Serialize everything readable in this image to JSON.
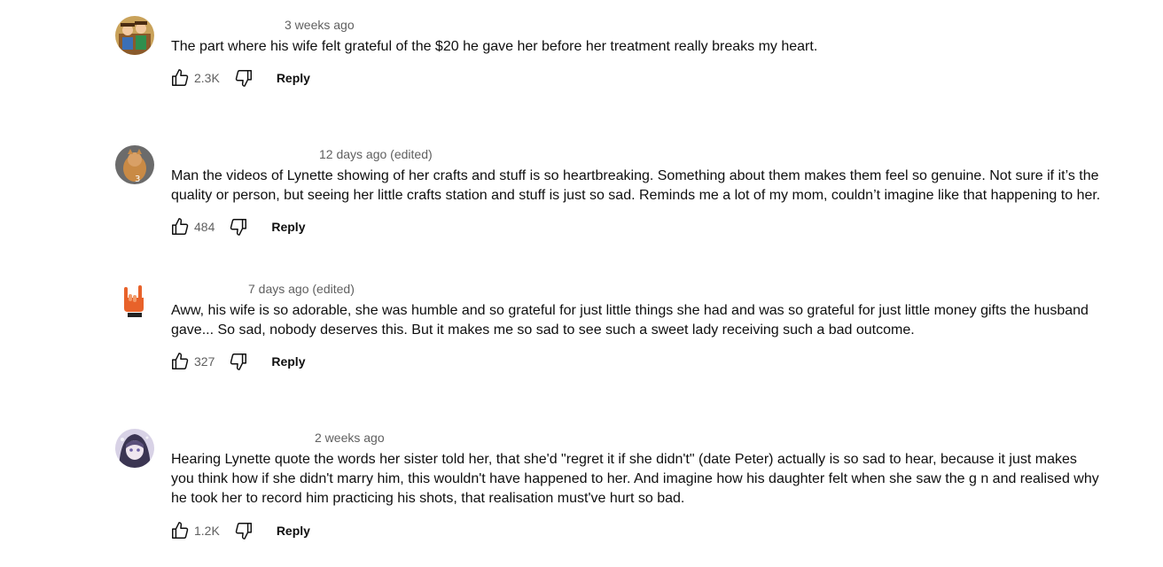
{
  "reply_label": "Reply",
  "icons": {
    "like": "thumbs-up-icon",
    "dislike": "thumbs-down-icon"
  },
  "colors": {
    "text_primary": "#0f0f0f",
    "text_secondary": "#606060"
  },
  "comments": [
    {
      "timestamp": "3 weeks ago",
      "text": "The part where his wife felt grateful of the $20 he gave her before her treatment really breaks my heart.",
      "likes": "2.3K"
    },
    {
      "timestamp": "12 days ago (edited)",
      "text": "Man the videos of Lynette showing of her crafts and stuff is so heartbreaking. Something about them makes them feel so genuine. Not sure if it’s the quality or person, but seeing her little crafts station and stuff is just so sad. Reminds me a lot of my mom, couldn’t imagine like that happening to her.",
      "likes": "484"
    },
    {
      "timestamp": "7 days ago (edited)",
      "text": "Aww, his wife is so adorable, she was humble and so grateful for just little things she had and was so grateful for just little money gifts the husband gave... So sad, nobody deserves this. But it makes me so sad to see such a sweet lady receiving such a bad outcome.",
      "likes": "327"
    },
    {
      "timestamp": "2 weeks ago",
      "text": "Hearing Lynette quote the words her sister told her, that she'd \"regret it if she didn't\" (date Peter) actually is so sad to hear, because it just makes you think how if she didn't marry him, this wouldn't have happened to her. And imagine how his daughter felt when she saw the g  n and realised why he took her to record him practicing his shots, that realisation must've hurt so bad.",
      "likes": "1.2K"
    }
  ]
}
